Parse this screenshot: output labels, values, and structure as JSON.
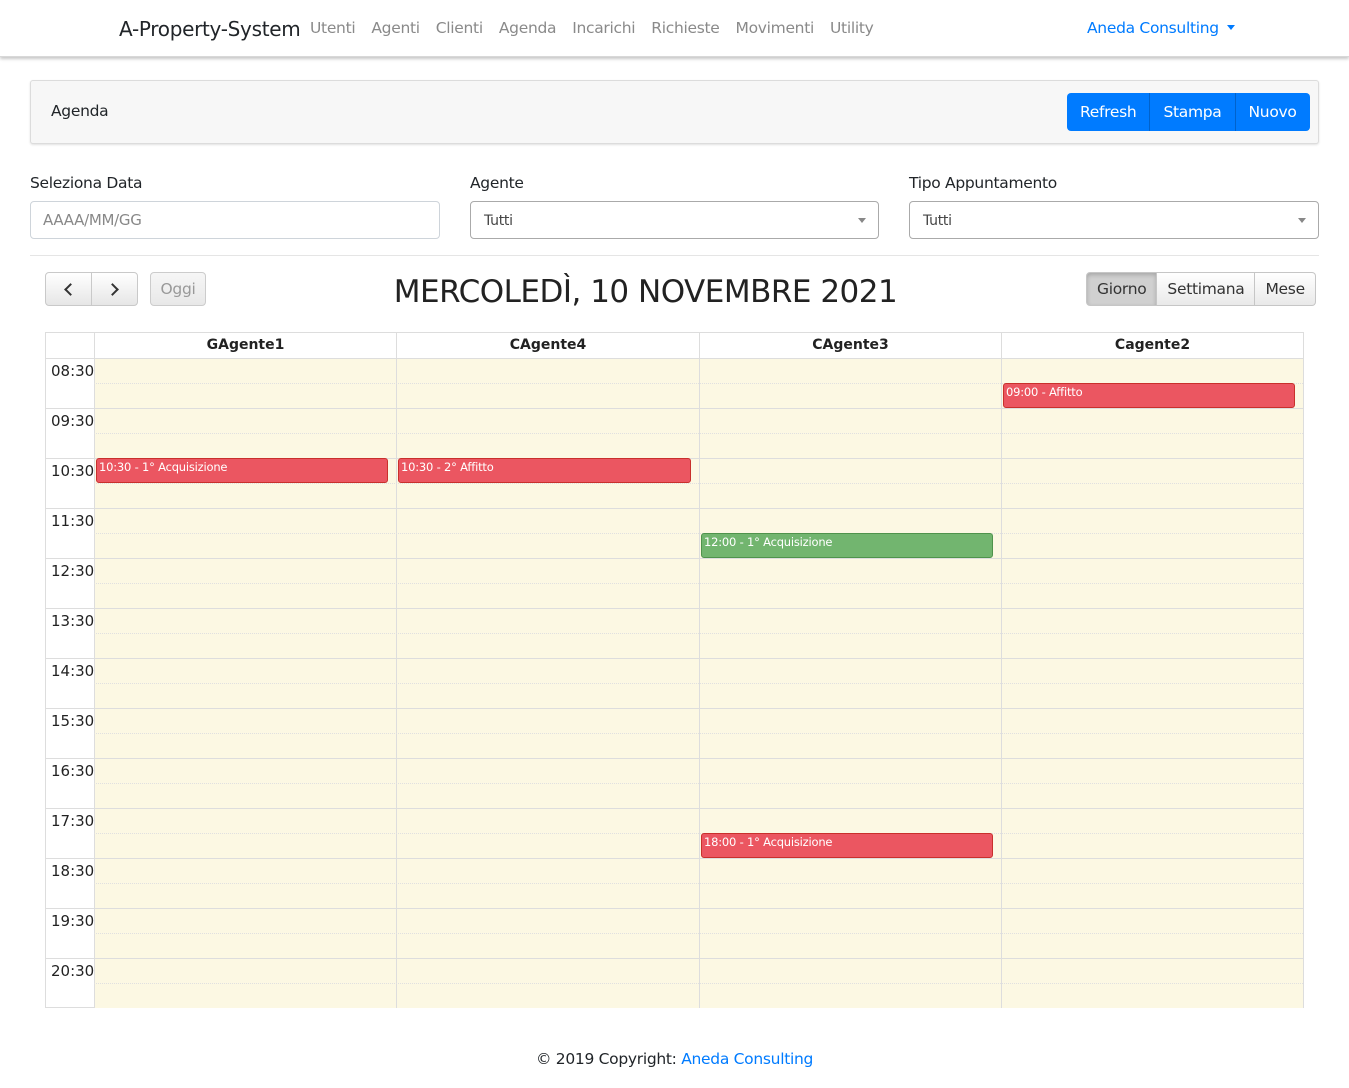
{
  "navbar": {
    "brand": "A-Property-System",
    "links": [
      "Utenti",
      "Agenti",
      "Clienti",
      "Agenda",
      "Incarichi",
      "Richieste",
      "Movimenti",
      "Utility"
    ],
    "user_menu": "Aneda Consulting"
  },
  "header": {
    "title": "Agenda",
    "buttons": {
      "refresh": "Refresh",
      "print": "Stampa",
      "new": "Nuovo"
    }
  },
  "filters": {
    "date": {
      "label": "Seleziona Data",
      "placeholder": "AAAA/MM/GG",
      "value": ""
    },
    "agent": {
      "label": "Agente",
      "value": "Tutti"
    },
    "type": {
      "label": "Tipo Appuntamento",
      "value": "Tutti"
    }
  },
  "calendar": {
    "today_label": "Oggi",
    "title": "MERCOLEDÌ, 10 NOVEMBRE 2021",
    "views": [
      {
        "label": "Giorno",
        "active": true
      },
      {
        "label": "Settimana",
        "active": false
      },
      {
        "label": "Mese",
        "active": false
      }
    ],
    "columns": [
      "GAgente1",
      "CAgente4",
      "CAgente3",
      "Cagente2"
    ],
    "time_labels": [
      "08:30",
      "09:30",
      "10:30",
      "11:30",
      "12:30",
      "13:30",
      "14:30",
      "15:30",
      "16:30",
      "17:30",
      "18:30",
      "19:30",
      "20:30"
    ],
    "events": [
      {
        "column": 3,
        "start": "09:00",
        "label": "09:00 -  Affitto",
        "color": "#eb5661"
      },
      {
        "column": 0,
        "start": "10:30",
        "label": "10:30 - 1° Acquisizione",
        "color": "#eb5661"
      },
      {
        "column": 1,
        "start": "10:30",
        "label": "10:30 - 2° Affitto",
        "color": "#eb5661"
      },
      {
        "column": 2,
        "start": "12:00",
        "label": "12:00 - 1° Acquisizione",
        "color": "#72b56f"
      },
      {
        "column": 2,
        "start": "18:00",
        "label": "18:00 - 1° Acquisizione",
        "color": "#eb5661"
      }
    ]
  },
  "footer": {
    "text": "© 2019 Copyright: ",
    "link": "Aneda Consulting"
  },
  "colors": {
    "primary": "#007bff",
    "event_red": "#eb5661",
    "event_green": "#72b56f",
    "slot_bg": "#fcf8e3"
  }
}
